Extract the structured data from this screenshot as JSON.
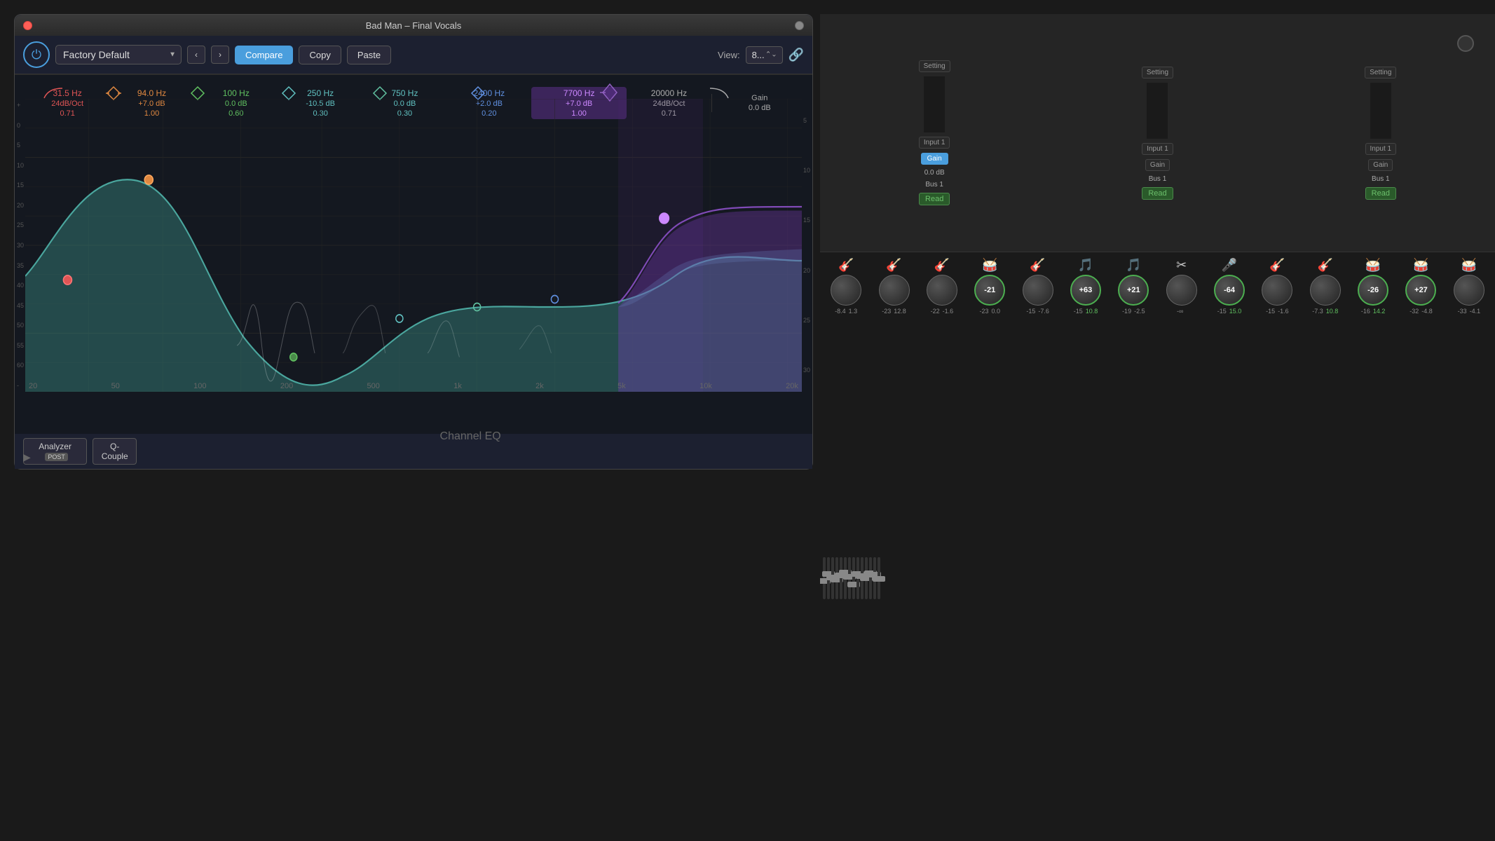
{
  "window": {
    "title": "Bad Man – Final Vocals",
    "close_btn": "●",
    "minimize_btn": "■"
  },
  "toolbar": {
    "preset_label": "Factory Default",
    "compare_label": "Compare",
    "copy_label": "Copy",
    "paste_label": "Paste",
    "view_label": "View:",
    "view_value": "8...",
    "power_icon": "⏻"
  },
  "bands": [
    {
      "freq": "31.5 Hz",
      "gain": "24dB/Oct",
      "q": "0.71",
      "color": "red",
      "enabled": true
    },
    {
      "freq": "94.0 Hz",
      "gain": "+7.0 dB",
      "q": "1.00",
      "color": "orange",
      "enabled": true
    },
    {
      "freq": "100 Hz",
      "gain": "0.0 dB",
      "q": "0.60",
      "color": "green",
      "enabled": true
    },
    {
      "freq": "250 Hz",
      "gain": "-10.5 dB",
      "q": "0.30",
      "color": "cyan",
      "enabled": true
    },
    {
      "freq": "750 Hz",
      "gain": "0.0 dB",
      "q": "0.30",
      "color": "cyan2",
      "enabled": true
    },
    {
      "freq": "2400 Hz",
      "gain": "+2.0 dB",
      "q": "0.20",
      "color": "blue",
      "enabled": true
    },
    {
      "freq": "7700 Hz",
      "gain": "+7.0 dB",
      "q": "1.00",
      "color": "purple",
      "enabled": true,
      "highlight": true
    },
    {
      "freq": "20000 Hz",
      "gain": "24dB/Oct",
      "q": "0.71",
      "color": "white",
      "enabled": true
    }
  ],
  "gain_label": "Gain",
  "gain_value": "0.0 dB",
  "freq_labels": [
    "20",
    "50",
    "100",
    "200",
    "500",
    "1k",
    "2k",
    "5k",
    "10k",
    "20k"
  ],
  "db_labels": [
    "+",
    "0",
    "5",
    "10",
    "15",
    "20",
    "25",
    "30",
    "35",
    "40",
    "45",
    "50",
    "55",
    "60",
    "-"
  ],
  "db_labels_right": [
    "5",
    "10",
    "15",
    "20",
    "25",
    "30"
  ],
  "bottom_buttons": {
    "analyzer_label": "Analyzer",
    "analyzer_badge": "POST",
    "q_couple_label": "Q-Couple",
    "channel_eq_label": "Channel EQ"
  },
  "mixer": {
    "channels": [
      {
        "setting": "Setting",
        "input": "Input 1",
        "gain": "Gain",
        "bus": "Bus 1",
        "read": "Read"
      },
      {
        "setting": "Setting",
        "input": "Input 1",
        "gain": "Gain",
        "bus": "Bus 1",
        "read": "Read"
      },
      {
        "setting": "Setting",
        "input": "Input 1",
        "gain": "Gain",
        "bus": "Bus 1",
        "read": "Read"
      }
    ]
  },
  "faders": [
    {
      "value": "-8.4",
      "value2": "1.3",
      "label": "",
      "color": "normal"
    },
    {
      "value": "-23",
      "value2": "12.8",
      "label": "",
      "color": "normal"
    },
    {
      "value": "-22",
      "value2": "-1.6",
      "label": "",
      "color": "normal"
    },
    {
      "value": "-23",
      "value2": "0.0",
      "label": "-21",
      "color": "green"
    },
    {
      "value": "-15",
      "value2": "-7.6",
      "label": "",
      "color": "normal"
    },
    {
      "value": "-15",
      "value2": "10.8",
      "label": "+63",
      "color": "green"
    },
    {
      "value": "-19",
      "value2": "-2.5",
      "label": "+21",
      "color": "green"
    },
    {
      "value": "-∞",
      "value2": "",
      "label": "",
      "color": "normal"
    },
    {
      "value": "-15",
      "value2": "15.0",
      "label": "-64",
      "color": "green"
    },
    {
      "value": "-15",
      "value2": "-1.6",
      "label": "",
      "color": "normal"
    },
    {
      "value": "-7.3",
      "value2": "10.8",
      "label": "",
      "color": "normal"
    },
    {
      "value": "-16",
      "value2": "14.2",
      "label": "-26",
      "color": "green"
    },
    {
      "value": "-32",
      "value2": "-4.8",
      "label": "+27",
      "color": "green"
    },
    {
      "value": "-33",
      "value2": "-4.1",
      "label": "",
      "color": "normal"
    }
  ]
}
